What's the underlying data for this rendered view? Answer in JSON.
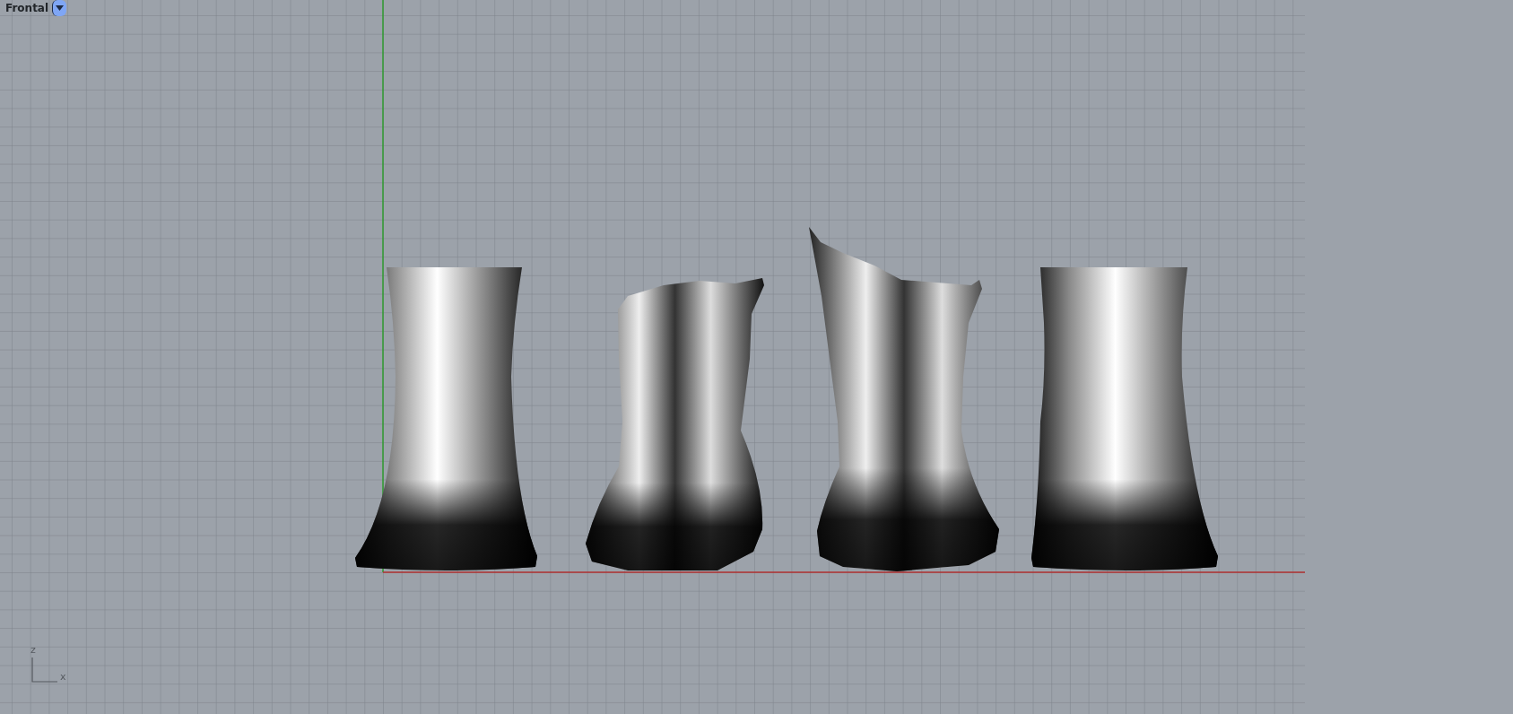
{
  "viewport": {
    "title": "Frontal"
  },
  "axis_widget": {
    "vertical_label": "z",
    "horizontal_label": "x"
  }
}
